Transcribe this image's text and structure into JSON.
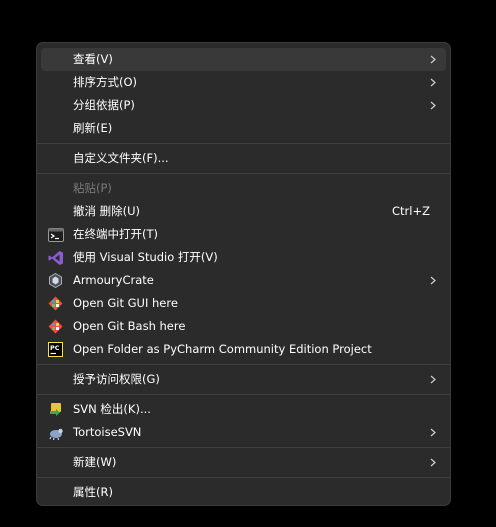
{
  "menu": {
    "items": [
      {
        "label": "查看(V)"
      },
      {
        "label": "排序方式(O)"
      },
      {
        "label": "分组依据(P)"
      },
      {
        "label": "刷新(E)"
      },
      {
        "label": "自定义文件夹(F)..."
      },
      {
        "label": "粘贴(P)"
      },
      {
        "label": "撤消 删除(U)",
        "shortcut": "Ctrl+Z"
      },
      {
        "label": "在终端中打开(T)"
      },
      {
        "label": "使用 Visual Studio 打开(V)"
      },
      {
        "label": "ArmouryCrate"
      },
      {
        "label": "Open Git GUI here"
      },
      {
        "label": "Open Git Bash here"
      },
      {
        "label": "Open Folder as PyCharm Community Edition Project"
      },
      {
        "label": "授予访问权限(G)"
      },
      {
        "label": "SVN 检出(K)..."
      },
      {
        "label": "TortoiseSVN"
      },
      {
        "label": "新建(W)"
      },
      {
        "label": "属性(R)"
      }
    ]
  },
  "icons": {
    "terminal": "terminal-icon",
    "visual_studio": "visual-studio-icon",
    "armoury_crate": "armoury-crate-icon",
    "git_gui": "git-gui-icon",
    "git_bash": "git-bash-icon",
    "pycharm": "pycharm-icon",
    "svn_checkout": "svn-checkout-icon",
    "tortoise_svn": "tortoisesvn-icon",
    "submenu_arrow": "chevron-right-icon"
  },
  "colors": {
    "menu_background": "#2b2b2b",
    "hover_background": "#393939",
    "text": "#ffffff",
    "disabled_text": "#7a7a7a",
    "separator": "#404040",
    "visual_studio_purple": "#8b5cd6",
    "git_orange": "#f05033"
  }
}
